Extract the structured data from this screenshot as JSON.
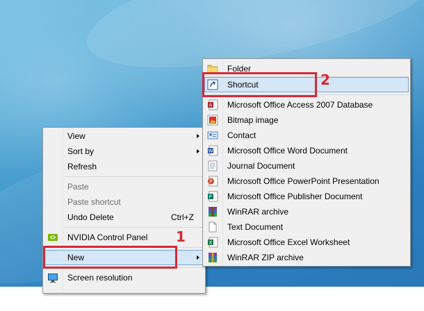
{
  "context_menu": {
    "items": [
      {
        "label": "View",
        "submenu": true
      },
      {
        "label": "Sort by",
        "submenu": true
      },
      {
        "label": "Refresh"
      },
      {
        "label": "Paste",
        "disabled": true
      },
      {
        "label": "Paste shortcut",
        "disabled": true
      },
      {
        "label": "Undo Delete",
        "shortcut": "Ctrl+Z"
      },
      {
        "label": "NVIDIA Control Panel",
        "icon": "nvidia-icon"
      },
      {
        "label": "New",
        "submenu": true,
        "highlighted": true
      },
      {
        "label": "Screen resolution",
        "icon": "monitor-icon"
      }
    ]
  },
  "new_submenu": {
    "items": [
      {
        "label": "Folder",
        "icon": "folder-icon"
      },
      {
        "label": "Shortcut",
        "icon": "shortcut-icon",
        "highlighted": true
      },
      {
        "label": "Microsoft Office Access 2007 Database",
        "icon": "access-icon"
      },
      {
        "label": "Bitmap image",
        "icon": "bitmap-icon"
      },
      {
        "label": "Contact",
        "icon": "contact-icon"
      },
      {
        "label": "Microsoft Office Word Document",
        "icon": "word-icon"
      },
      {
        "label": "Journal Document",
        "icon": "journal-icon"
      },
      {
        "label": "Microsoft Office PowerPoint Presentation",
        "icon": "powerpoint-icon"
      },
      {
        "label": "Microsoft Office Publisher Document",
        "icon": "publisher-icon"
      },
      {
        "label": "WinRAR archive",
        "icon": "winrar-icon"
      },
      {
        "label": "Text Document",
        "icon": "text-document-icon"
      },
      {
        "label": "Microsoft Office Excel Worksheet",
        "icon": "excel-icon"
      },
      {
        "label": "WinRAR ZIP archive",
        "icon": "winrar-zip-icon"
      }
    ]
  },
  "annotations": {
    "step1": "1",
    "step2": "2"
  },
  "colors": {
    "highlight": "#d5e6f7",
    "highlight_border": "#7aa7dc",
    "callout": "#d42a35",
    "menu_bg": "#f0f0f0"
  }
}
